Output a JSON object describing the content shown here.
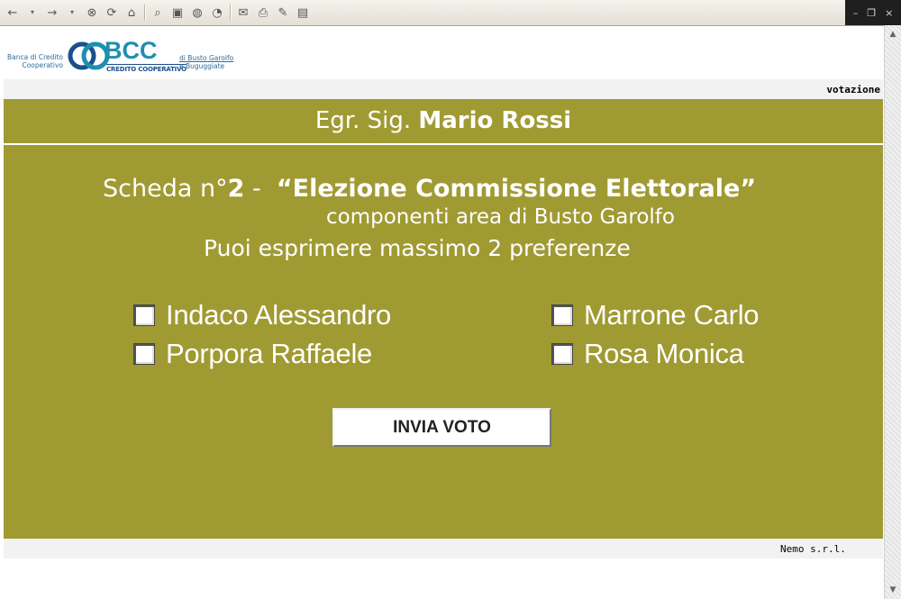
{
  "browser": {
    "toolbar_buttons": [
      {
        "name": "back-icon",
        "glyph": "←"
      },
      {
        "name": "back-dropdown-icon",
        "glyph": "▾"
      },
      {
        "name": "forward-icon",
        "glyph": "→"
      },
      {
        "name": "forward-dropdown-icon",
        "glyph": "▾"
      },
      {
        "name": "stop-icon",
        "glyph": "⊗"
      },
      {
        "name": "refresh-icon",
        "glyph": "⟳"
      },
      {
        "name": "home-icon",
        "glyph": "⌂"
      },
      {
        "name": "search-icon",
        "glyph": "⌕"
      },
      {
        "name": "favorites-icon",
        "glyph": "▣"
      },
      {
        "name": "media-icon",
        "glyph": "◍"
      },
      {
        "name": "history-icon",
        "glyph": "◔"
      },
      {
        "name": "mail-icon",
        "glyph": "✉"
      },
      {
        "name": "print-icon",
        "glyph": "⎙"
      },
      {
        "name": "edit-icon",
        "glyph": "✎"
      },
      {
        "name": "discuss-icon",
        "glyph": "▤"
      }
    ],
    "window_controls": {
      "minimize": "–",
      "restore": "❐",
      "close": "×"
    }
  },
  "header": {
    "logo": {
      "left_text_1": "Banca di Credito",
      "left_text_2": "Cooperativo",
      "brand": "BCC",
      "subbrand": "CREDITO COOPERATIVO",
      "right_text_1": "di Busto Garolfo",
      "right_text_2": "e Buguggiate"
    },
    "section_label": "votazione"
  },
  "ballot": {
    "greeting_prefix": "Egr. Sig.",
    "voter_name": "Mario Rossi",
    "scheda_prefix": "Scheda n°",
    "scheda_number": "2",
    "scheda_sep": " -  ",
    "election_title": "“Elezione Commissione Elettorale”",
    "subtitle": "componenti area di Busto Garolfo",
    "instructions": "Puoi esprimere massimo 2 preferenze",
    "candidates": [
      {
        "label": "Indaco Alessandro",
        "checked": false
      },
      {
        "label": "Marrone Carlo",
        "checked": false
      },
      {
        "label": "Porpora Raffaele",
        "checked": false
      },
      {
        "label": "Rosa Monica",
        "checked": false
      }
    ],
    "submit_label": "INVIA VOTO"
  },
  "footer": {
    "credit": "Nemo s.r.l."
  },
  "colors": {
    "panel": "#a09a33",
    "brand_blue": "#1f8fae",
    "brand_dark": "#1b4f8a"
  }
}
